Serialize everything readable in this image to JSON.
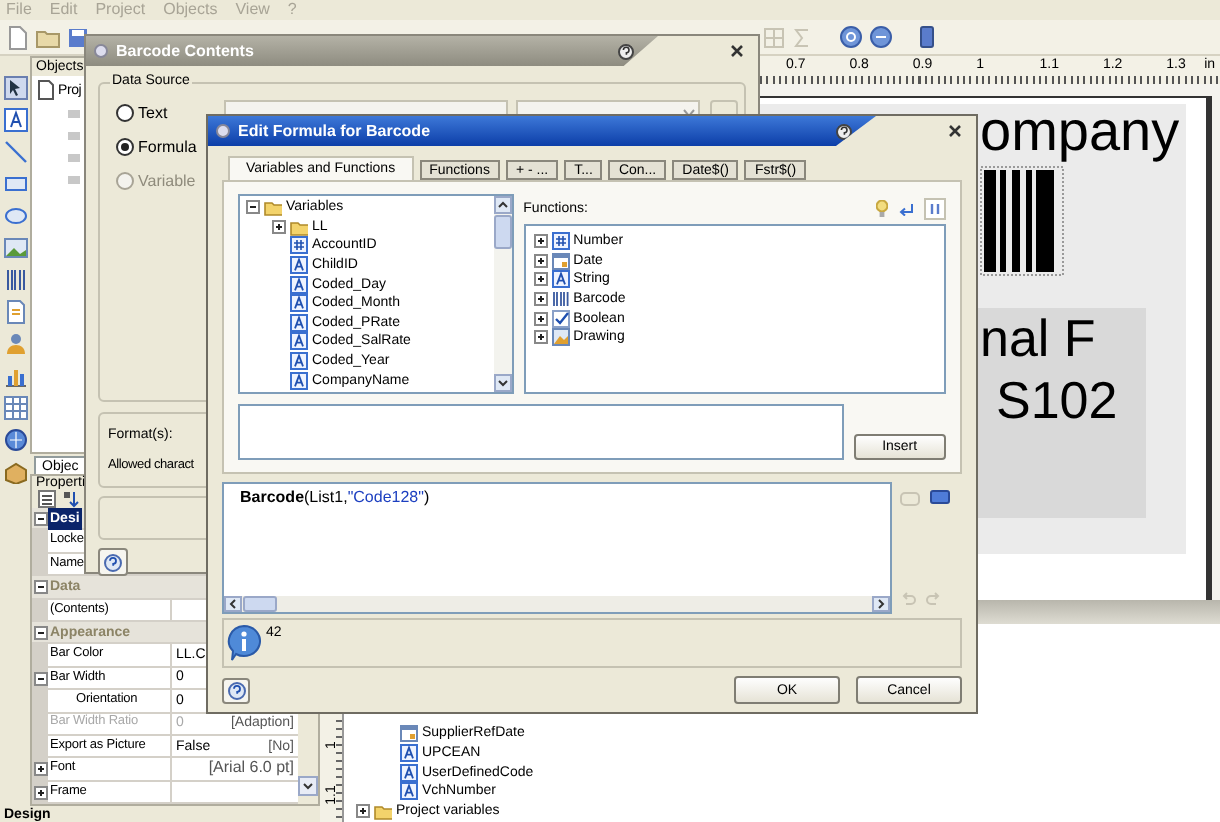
{
  "menu_bar": [
    "File",
    "Edit",
    "Project",
    "Objects",
    "View",
    "?"
  ],
  "objects_panel": {
    "title": "Objects",
    "root": "Proj",
    "tab": "Objec"
  },
  "properties_panel": {
    "title": "Properti",
    "groups": [
      {
        "name": "Desi",
        "selected": true,
        "expanded": true,
        "rows": [
          {
            "name": "Locke"
          },
          {
            "name": "Name"
          }
        ]
      },
      {
        "name": "Data",
        "selected": false,
        "expanded": true,
        "rows": [
          {
            "name": "(Contents)"
          }
        ]
      },
      {
        "name": "Appearance",
        "selected": false,
        "expanded": true,
        "rows": [
          {
            "name": "Bar Color",
            "value": "LL.C"
          },
          {
            "name": "Bar Width",
            "value": "0",
            "expanded": true,
            "children": [
              {
                "name": "Orientation",
                "value": "0"
              }
            ]
          },
          {
            "name": "Bar Width Ratio",
            "value": "0",
            "note": "[Adaption]",
            "disabled": true
          },
          {
            "name": "Export as Picture",
            "value": "False",
            "note": "[No]",
            "disabled": false
          },
          {
            "name": "Font",
            "note": "[Arial 6.0 pt]",
            "expanded": false
          },
          {
            "name": "Frame",
            "expanded": false
          }
        ]
      }
    ]
  },
  "vertical_ruler": [
    "1",
    "1.1"
  ],
  "variable_list": [
    {
      "label": "SupplierRefDate",
      "kind": "date"
    },
    {
      "label": "UPCEAN",
      "kind": "string"
    },
    {
      "label": "UserDefinedCode",
      "kind": "string"
    },
    {
      "label": "VchNumber",
      "kind": "string"
    },
    {
      "label": "Project variables",
      "kind": "folder",
      "expanded": false,
      "root": true
    }
  ],
  "ruler": [
    "0.7",
    "0.8",
    "0.9",
    "1",
    "1.1",
    "1.2",
    "1.3",
    "in"
  ],
  "canvas": {
    "title": "ompany",
    "field_lines": [
      "nal F",
      "S102"
    ]
  },
  "status_bar": "Design",
  "barcode_contents": {
    "title": "Barcode Contents",
    "group": "Data Source",
    "sources": [
      {
        "label": "Text",
        "selected": false,
        "disabled": false
      },
      {
        "label": "Formula",
        "selected": true,
        "disabled": false
      },
      {
        "label": "Variable",
        "selected": false,
        "disabled": true
      }
    ],
    "format_label": "Format(s):",
    "allowed_label": "Allowed charact"
  },
  "edit_formula": {
    "title": "Edit Formula for Barcode",
    "tabs": [
      {
        "label": "Variables and Functions",
        "selected": true
      },
      {
        "label": "Functions",
        "selected": false
      },
      {
        "label": "+ - ...",
        "selected": false
      },
      {
        "label": "T...",
        "selected": false
      },
      {
        "label": "Con...",
        "selected": false
      },
      {
        "label": "Date$()",
        "selected": false
      },
      {
        "label": "Fstr$()",
        "selected": false
      }
    ],
    "variables": {
      "label": "Variables",
      "kind": "folder",
      "expanded": true,
      "children": [
        {
          "label": "LL",
          "kind": "folder",
          "expanded": false
        },
        {
          "label": "AccountID",
          "kind": "number"
        },
        {
          "label": "ChildID",
          "kind": "string"
        },
        {
          "label": "Coded_Day",
          "kind": "string"
        },
        {
          "label": "Coded_Month",
          "kind": "string"
        },
        {
          "label": "Coded_PRate",
          "kind": "string"
        },
        {
          "label": "Coded_SalRate",
          "kind": "string"
        },
        {
          "label": "Coded_Year",
          "kind": "string"
        },
        {
          "label": "CompanyName",
          "kind": "string"
        }
      ]
    },
    "functions_label": "Functions:",
    "functions": [
      {
        "label": "Number",
        "kind": "number",
        "expanded": false
      },
      {
        "label": "Date",
        "kind": "date",
        "expanded": false
      },
      {
        "label": "String",
        "kind": "string",
        "expanded": false
      },
      {
        "label": "Barcode",
        "kind": "barcode",
        "expanded": false
      },
      {
        "label": "Boolean",
        "kind": "boolean",
        "expanded": false
      },
      {
        "label": "Drawing",
        "kind": "drawing",
        "expanded": false
      }
    ],
    "insert_button": "Insert",
    "formula": [
      {
        "text": "Barcode",
        "kind": "function"
      },
      {
        "text": "(List1,",
        "kind": "plain"
      },
      {
        "text": "\"Code128\"",
        "kind": "string"
      },
      {
        "text": ")",
        "kind": "plain"
      }
    ],
    "result": "42",
    "buttons": [
      "OK",
      "Cancel"
    ]
  }
}
